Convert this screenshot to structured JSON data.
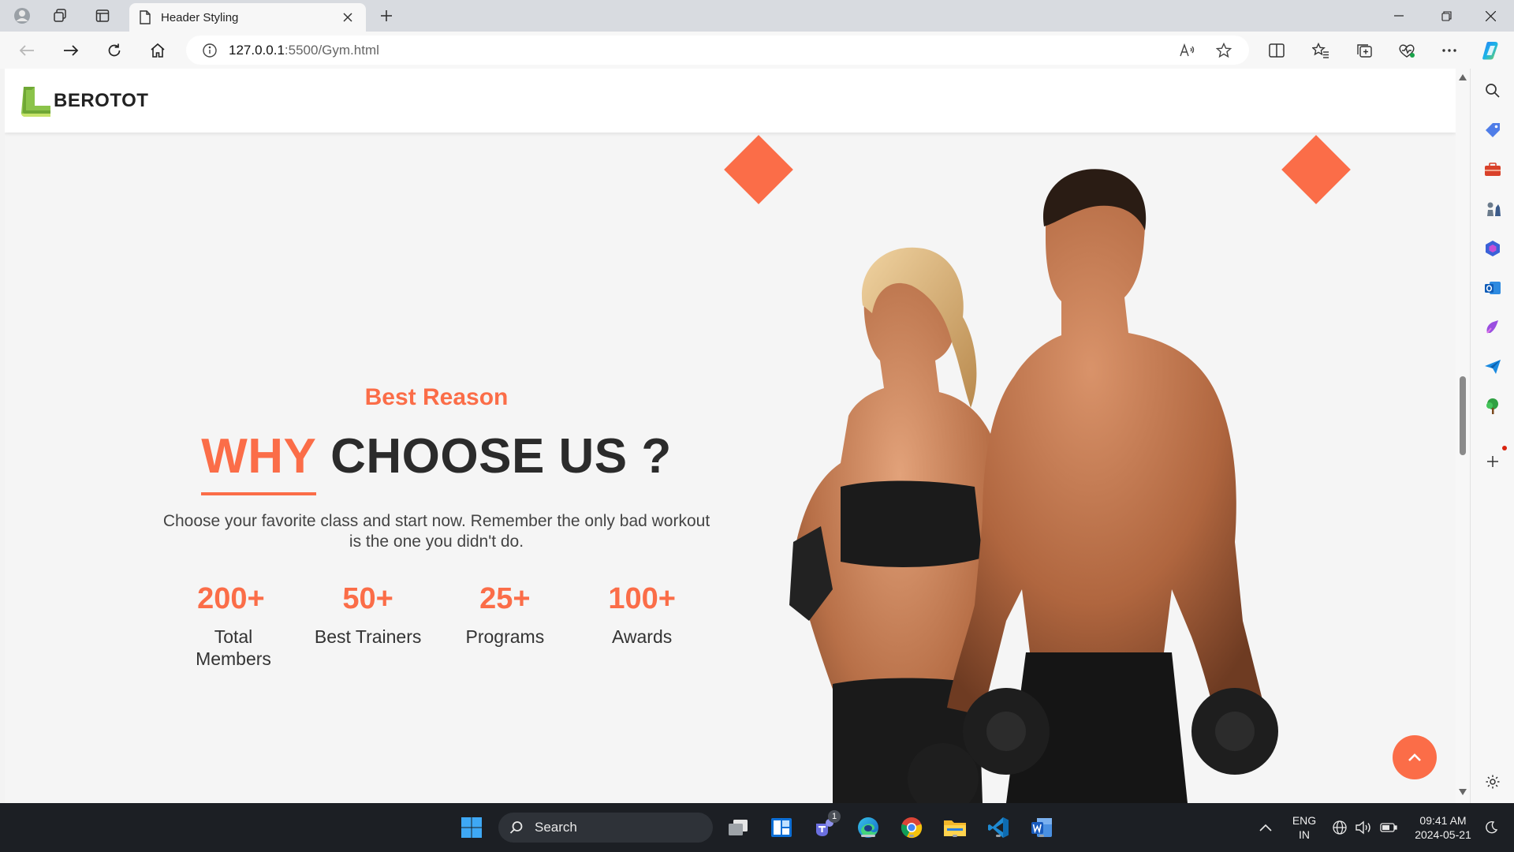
{
  "browser": {
    "tab_title": "Header Styling",
    "address_host": "127.0.0.1",
    "address_path": ":5500/Gym.html"
  },
  "site": {
    "brand": "BEROTOT",
    "subtitle": "Best Reason",
    "title_accent": "WHY",
    "title_rest": " CHOOSE US ?",
    "description": "Choose your favorite class and start now. Remember the only bad workout is the one you didn't do.",
    "stats": [
      {
        "number": "200+",
        "label": "Total Members"
      },
      {
        "number": "50+",
        "label": "Best Trainers"
      },
      {
        "number": "25+",
        "label": "Programs"
      },
      {
        "number": "100+",
        "label": "Awards"
      }
    ],
    "accent_color": "#fb6d48"
  },
  "taskbar": {
    "search_label": "Search",
    "lang_line1": "ENG",
    "lang_line2": "IN",
    "time": "09:41 AM",
    "date": "2024-05-21",
    "teams_badge": "1"
  }
}
